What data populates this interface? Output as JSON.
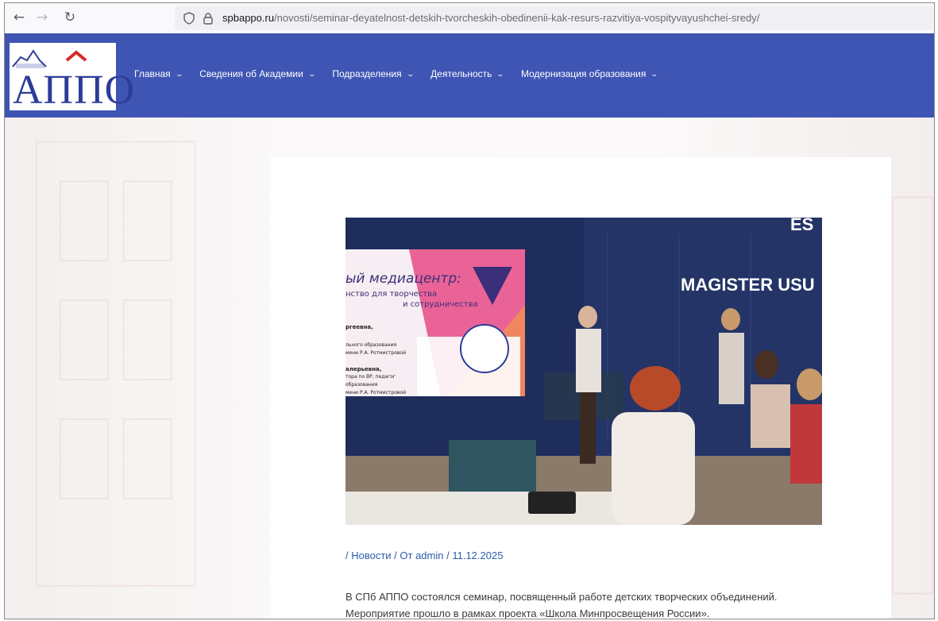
{
  "browser": {
    "url_host": "spbappo.ru",
    "url_path": "/novosti/seminar-deyatelnost-detskih-tvorcheskih-obedinenii-kak-resurs-razvitiya-vospityvayushchei-sredy/",
    "icons": [
      "back-arrow-icon",
      "forward-arrow-icon",
      "reload-icon",
      "shield-icon",
      "lock-icon"
    ]
  },
  "site": {
    "logo_text": "АППО",
    "menu": [
      {
        "label": "Главная"
      },
      {
        "label": "Сведения об Академии"
      },
      {
        "label": "Подразделения"
      },
      {
        "label": "Деятельность"
      },
      {
        "label": "Модернизация образования"
      }
    ],
    "colors": {
      "header": "#3f55b3",
      "link": "#2e5ea8"
    }
  },
  "article": {
    "photo": {
      "screen_title": "ый медиацентр:",
      "screen_sub1": "нство для творчества",
      "screen_sub2": "и сотрудничества",
      "screen_name1": "ргеевна,",
      "screen_line1": "льного образования",
      "screen_line2": "мени Р.А. Ротмистровой",
      "screen_name2": "алерьевна,",
      "screen_line3": "тора по ВР, педагог",
      "screen_line4": "образования",
      "screen_line5": "мени Р.А. Ротмистровой",
      "wall_text": "MAGISTER USU",
      "wall_top": "ES"
    },
    "meta": {
      "prefix": "/ ",
      "category": "Новости",
      "sep1": " / От ",
      "author": "admin",
      "sep2": " / ",
      "date": "11.12.2025"
    },
    "body_line1": "В СПб АППО состоялся семинар, посвященный работе детских творческих объединений.",
    "body_line2": "Мероприятие прошло в рамках проекта «Школа Минпросвещения России»."
  }
}
